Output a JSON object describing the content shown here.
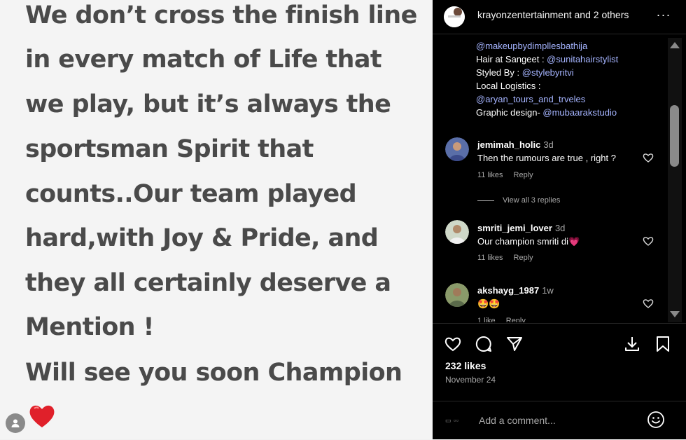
{
  "post_image": {
    "caption_lines": [
      "We don’t cross the finish line",
      "in every match of Life that",
      "we play, but it’s always the",
      "sportsman Spirit that",
      "counts..Our team played",
      "hard,with Joy & Pride, and",
      "they all certainly deserve a",
      "Mention !",
      "Will see you soon Champion"
    ]
  },
  "header": {
    "names": "krayonzentertainment and 2 others",
    "more_label": "···"
  },
  "caption": {
    "lines": [
      {
        "prefix": "",
        "link": "@makeupbydimpllesbathija"
      },
      {
        "prefix": "Hair at Sangeet : ",
        "link": "@sunitahairstylist"
      },
      {
        "prefix": "Styled By : ",
        "link": "@stylebyritvi"
      },
      {
        "prefix": "Local Logistics :",
        "link": ""
      },
      {
        "prefix": "",
        "link": "@aryan_tours_and_trveles"
      },
      {
        "prefix": "Graphic design- ",
        "link": "@mubaarakstudio"
      }
    ]
  },
  "comments": [
    {
      "user": "jemimah_holic",
      "time": "3d",
      "text": "Then the rumours are true , right ?",
      "likes": "11 likes",
      "reply": "Reply"
    },
    {
      "user": "smriti_jemi_lover",
      "time": "3d",
      "text": "Our champion smriti di💗",
      "likes": "11 likes",
      "reply": "Reply"
    },
    {
      "user": "akshayg_1987",
      "time": "1w",
      "text": "🤩🤩",
      "likes": "1 like",
      "reply": "Reply"
    }
  ],
  "view_replies": "View all 3 replies",
  "actions": {
    "likes": "232 likes",
    "date": "November 24"
  },
  "add_comment": {
    "placeholder": "Add a comment..."
  },
  "colors": {
    "panel_bg": "#000000",
    "link": "#a5b4ff",
    "muted": "#a8a8a8",
    "heart_red": "#e0202a"
  }
}
